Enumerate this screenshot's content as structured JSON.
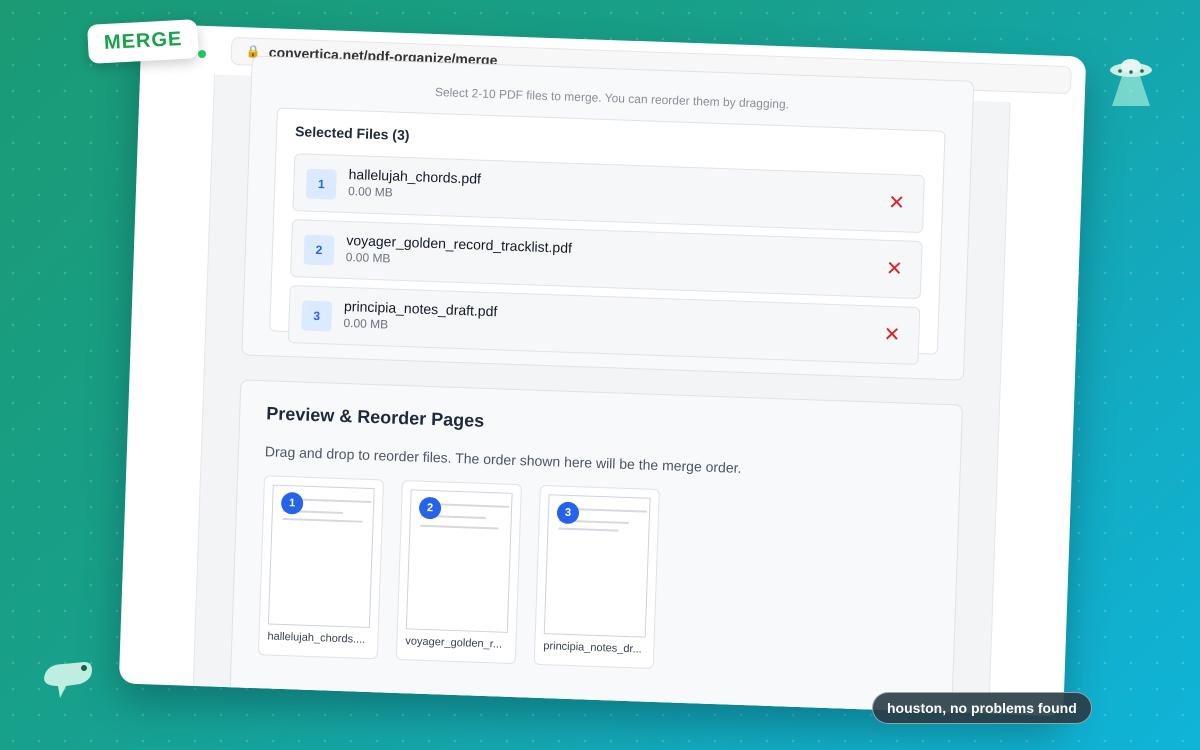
{
  "tag": {
    "label": "MERGE"
  },
  "browser": {
    "url": "convertica.net/pdf-organize/merge"
  },
  "upload": {
    "hint": "Select 2-10 PDF files to merge. You can reorder them by dragging."
  },
  "files": {
    "title": "Selected Files (3)",
    "items": [
      {
        "num": "1",
        "name": "hallelujah_chords.pdf",
        "size": "0.00 MB"
      },
      {
        "num": "2",
        "name": "voyager_golden_record_tracklist.pdf",
        "size": "0.00 MB"
      },
      {
        "num": "3",
        "name": "principia_notes_draft.pdf",
        "size": "0.00 MB"
      }
    ]
  },
  "preview": {
    "title": "Preview & Reorder Pages",
    "description": "Drag and drop to reorder files. The order shown here will be the merge order.",
    "thumbs": [
      {
        "num": "1",
        "label": "hallelujah_chords...."
      },
      {
        "num": "2",
        "label": "voyager_golden_r..."
      },
      {
        "num": "3",
        "label": "principia_notes_dr..."
      }
    ]
  },
  "toast": {
    "text": "houston, no problems found"
  },
  "colors": {
    "accent": "#2563eb",
    "remove": "#dc2626",
    "tag": "#16a34a"
  },
  "icons": {
    "lock": "lock-icon",
    "remove": "close-icon",
    "ufo": "ufo-icon",
    "creature": "creature-icon"
  }
}
